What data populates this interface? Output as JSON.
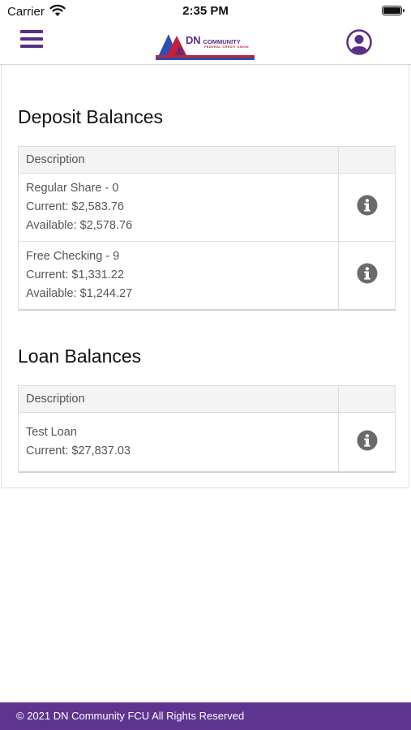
{
  "status_bar": {
    "carrier": "Carrier",
    "time": "2:35 PM"
  },
  "header": {
    "logo": {
      "name": "DN",
      "word": "COMMUNITY",
      "subtitle": "FEDERAL CREDIT UNION"
    }
  },
  "colors": {
    "brand_purple": "#5b2d86",
    "brand_red": "#c4203a",
    "brand_blue": "#2a4fb5",
    "footer": "#5f3490"
  },
  "deposit": {
    "title": "Deposit Balances",
    "column": "Description",
    "rows": [
      {
        "name": "Regular Share - 0",
        "current": "Current: $2,583.76",
        "available": "Available: $2,578.76"
      },
      {
        "name": "Free Checking - 9",
        "current": "Current: $1,331.22",
        "available": "Available: $1,244.27"
      }
    ]
  },
  "loan": {
    "title": "Loan Balances",
    "column": "Description",
    "rows": [
      {
        "name": "Test Loan",
        "current": "Current: $27,837.03"
      }
    ]
  },
  "icons": {
    "menu": "hamburger-icon",
    "profile": "user-circle-icon",
    "info": "info-circle-icon"
  },
  "footer": {
    "text": "© 2021 DN Community FCU All Rights Reserved"
  }
}
